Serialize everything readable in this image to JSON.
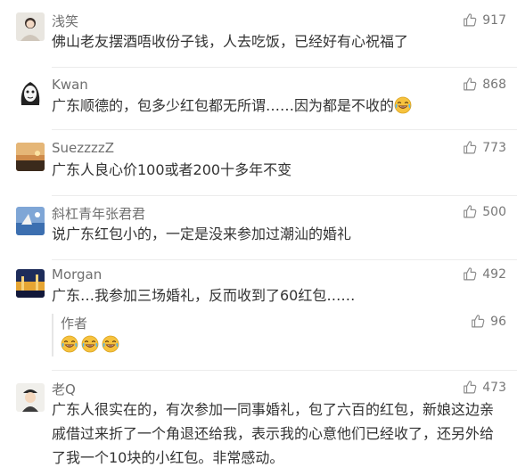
{
  "comments": [
    {
      "user": "浅笑",
      "likes": "917",
      "text": "佛山老友摆酒唔收份子钱，人去吃饭，已经好有心祝福了"
    },
    {
      "user": "Kwan",
      "likes": "868",
      "text": "广东顺德的，包多少红包都无所谓……因为都是不收的"
    },
    {
      "user": "SuezzzzZ",
      "likes": "773",
      "text": "广东人良心价100或者200十多年不变"
    },
    {
      "user": "斜杠青年张君君",
      "likes": "500",
      "text": "说广东红包小的，一定是没来参加过潮汕的婚礼"
    },
    {
      "user": "Morgan",
      "likes": "492",
      "text": "广东…我参加三场婚礼，反而收到了60红包……",
      "reply": {
        "user": "作者",
        "likes": "96"
      }
    },
    {
      "user": "老Q",
      "likes": "473",
      "text": "广东人很实在的，有次参加一同事婚礼，包了六百的红包，新娘这边亲戚借过来折了一个角退还给我，表示我的心意他们已经收了，还另外给了我一个10块的小红包。非常感动。"
    }
  ],
  "icons": {
    "like": "thumbs-up-icon",
    "emoji": "laughing-tears-emoji"
  },
  "colors": {
    "username": "#6f6f6f",
    "text": "#333333",
    "like": "#777777",
    "emoji": "#f6c23e"
  }
}
